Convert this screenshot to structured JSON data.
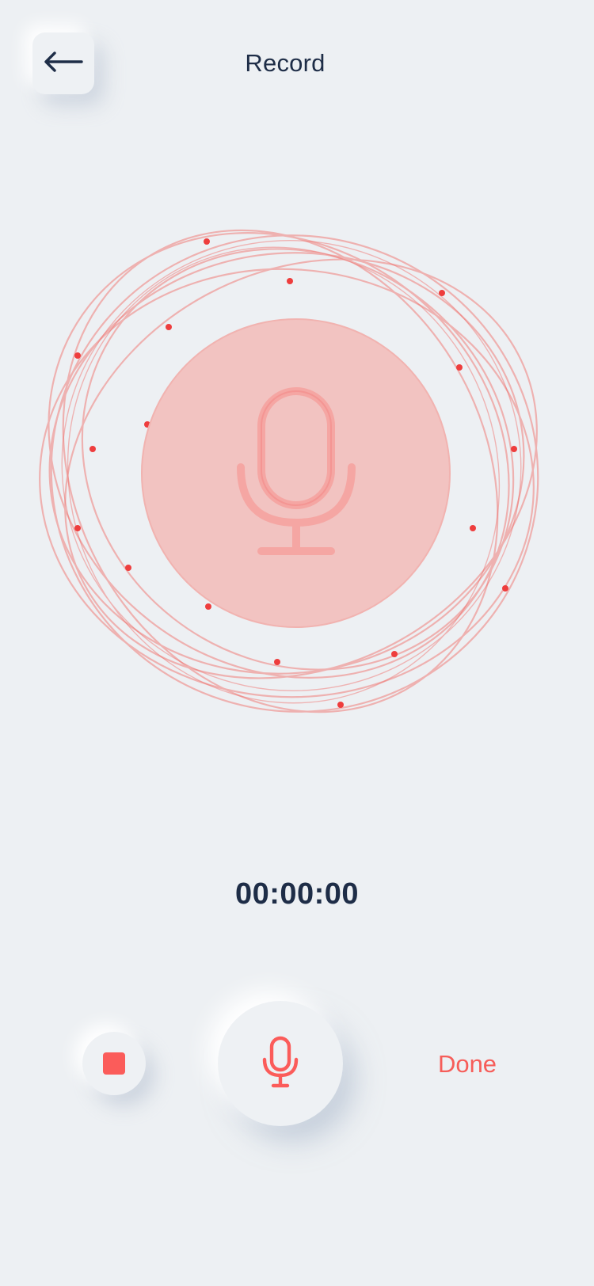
{
  "header": {
    "title": "Record",
    "back_icon": "arrow-left-icon"
  },
  "visualizer": {
    "center_icon": "microphone-icon",
    "accent_color": "#f06a66",
    "disc_color": "#f2c3c1"
  },
  "timer": {
    "value": "00:00:00"
  },
  "controls": {
    "stop_icon": "stop-icon",
    "record_icon": "microphone-icon",
    "done_label": "Done",
    "accent_color": "#fb5c5a"
  }
}
